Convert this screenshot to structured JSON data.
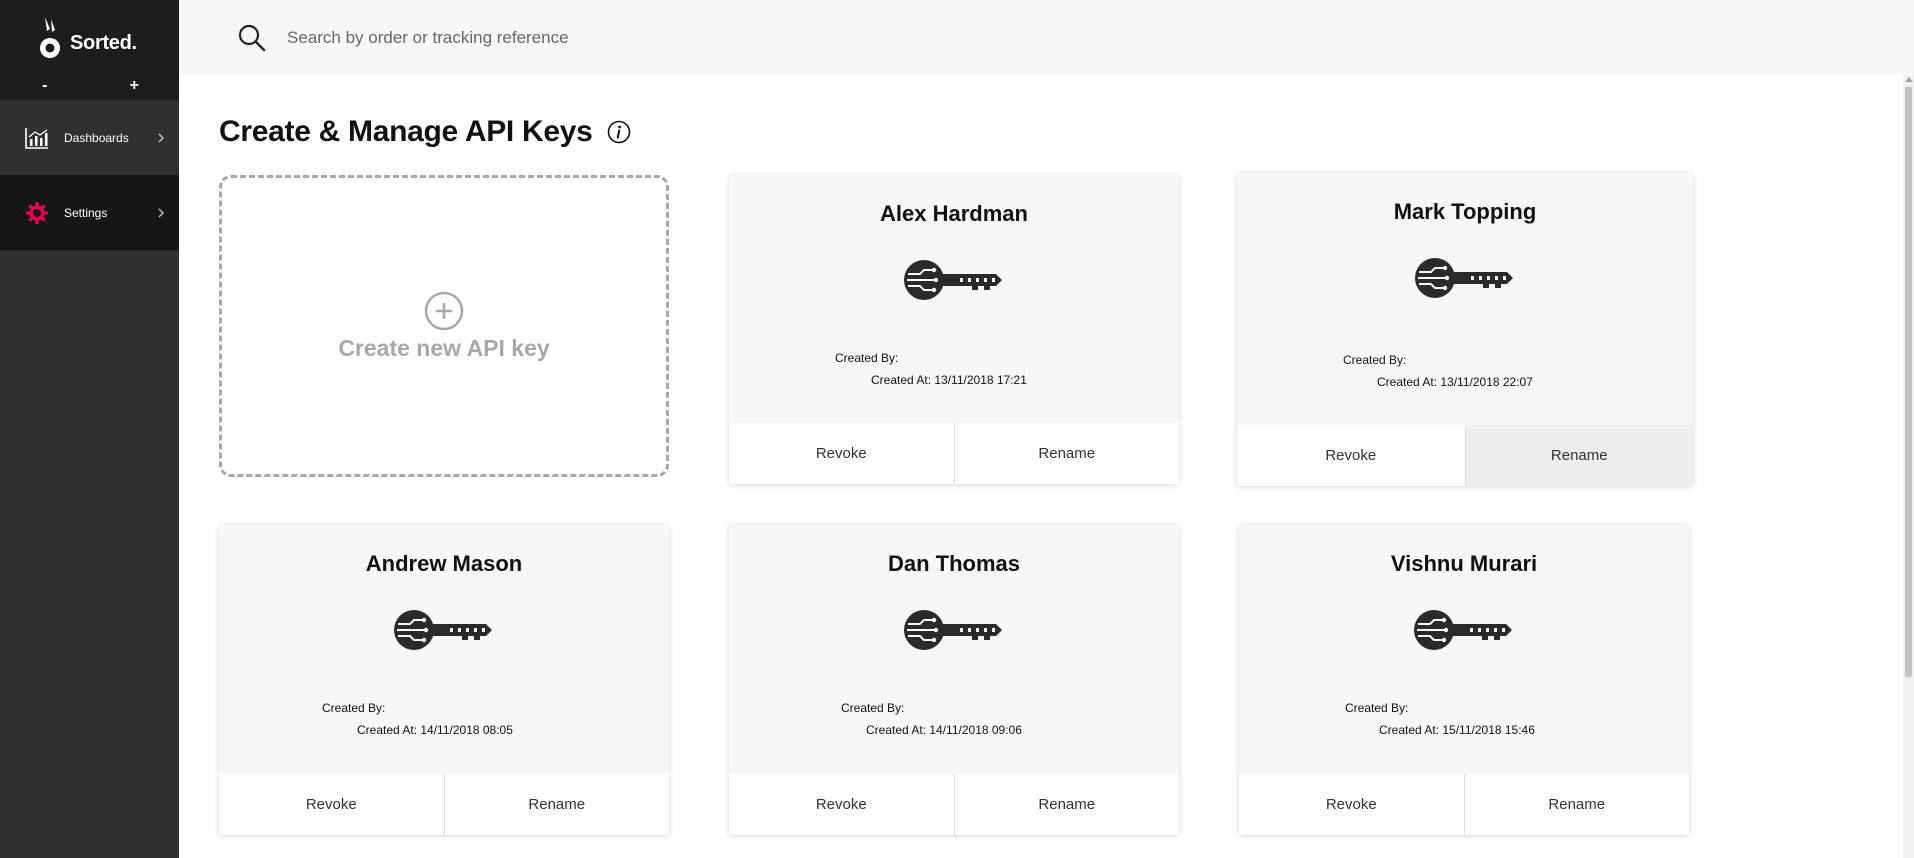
{
  "app": {
    "brand": "Sorted."
  },
  "sidebar": {
    "zoom_out": "-",
    "zoom_in": "+",
    "items": [
      {
        "label": "Dashboards",
        "icon": "bar-chart-icon"
      },
      {
        "label": "Settings",
        "icon": "gear-icon",
        "active": true
      }
    ]
  },
  "search": {
    "placeholder": "Search by order or tracking reference"
  },
  "page": {
    "title": "Create & Manage API Keys"
  },
  "create": {
    "label": "Create new API key"
  },
  "cards": [
    {
      "name": "Alex Hardman",
      "created_by_label": "Created By:",
      "created_at": "Created At: 13/11/2018 17:21",
      "revoke": "Revoke",
      "rename": "Rename"
    },
    {
      "name": "Mark Topping",
      "created_by_label": "Created By:",
      "created_at": "Created At: 13/11/2018 22:07",
      "revoke": "Revoke",
      "rename": "Rename"
    },
    {
      "name": "Andrew Mason",
      "created_by_label": "Created By:",
      "created_at": "Created At: 14/11/2018 08:05",
      "revoke": "Revoke",
      "rename": "Rename"
    },
    {
      "name": "Dan Thomas",
      "created_by_label": "Created By:",
      "created_at": "Created At: 14/11/2018 09:06",
      "revoke": "Revoke",
      "rename": "Rename"
    },
    {
      "name": "Vishnu Murari",
      "created_by_label": "Created By:",
      "created_at": "Created At: 15/11/2018 15:46",
      "revoke": "Revoke",
      "rename": "Rename"
    }
  ],
  "colors": {
    "accent": "#e5004f",
    "sidebar": "#303030",
    "sidebar_dark": "#1d1d1d"
  }
}
